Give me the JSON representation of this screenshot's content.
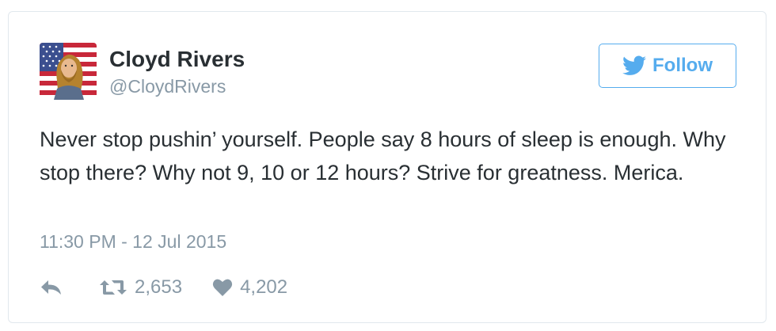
{
  "tweet": {
    "author": {
      "display_name": "Cloyd Rivers",
      "handle": "@CloydRivers",
      "avatar_icon": "flag-portrait-avatar"
    },
    "follow_button": {
      "label": "Follow",
      "icon": "twitter-bird-icon",
      "color": "#55acee"
    },
    "text": "Never stop pushin’ yourself. People say 8 hours of sleep is enough. Why stop there? Why not 9, 10 or 12 hours? Strive for greatness. Merica.",
    "timestamp": "11:30 PM - 12 Jul 2015",
    "actions": {
      "reply_icon": "reply-icon",
      "retweet_icon": "retweet-icon",
      "retweet_count": "2,653",
      "like_icon": "heart-icon",
      "like_count": "4,202"
    }
  },
  "colors": {
    "text_primary": "#292f33",
    "text_secondary": "#8899a6",
    "accent": "#55acee",
    "border": "#e1e8ed"
  }
}
